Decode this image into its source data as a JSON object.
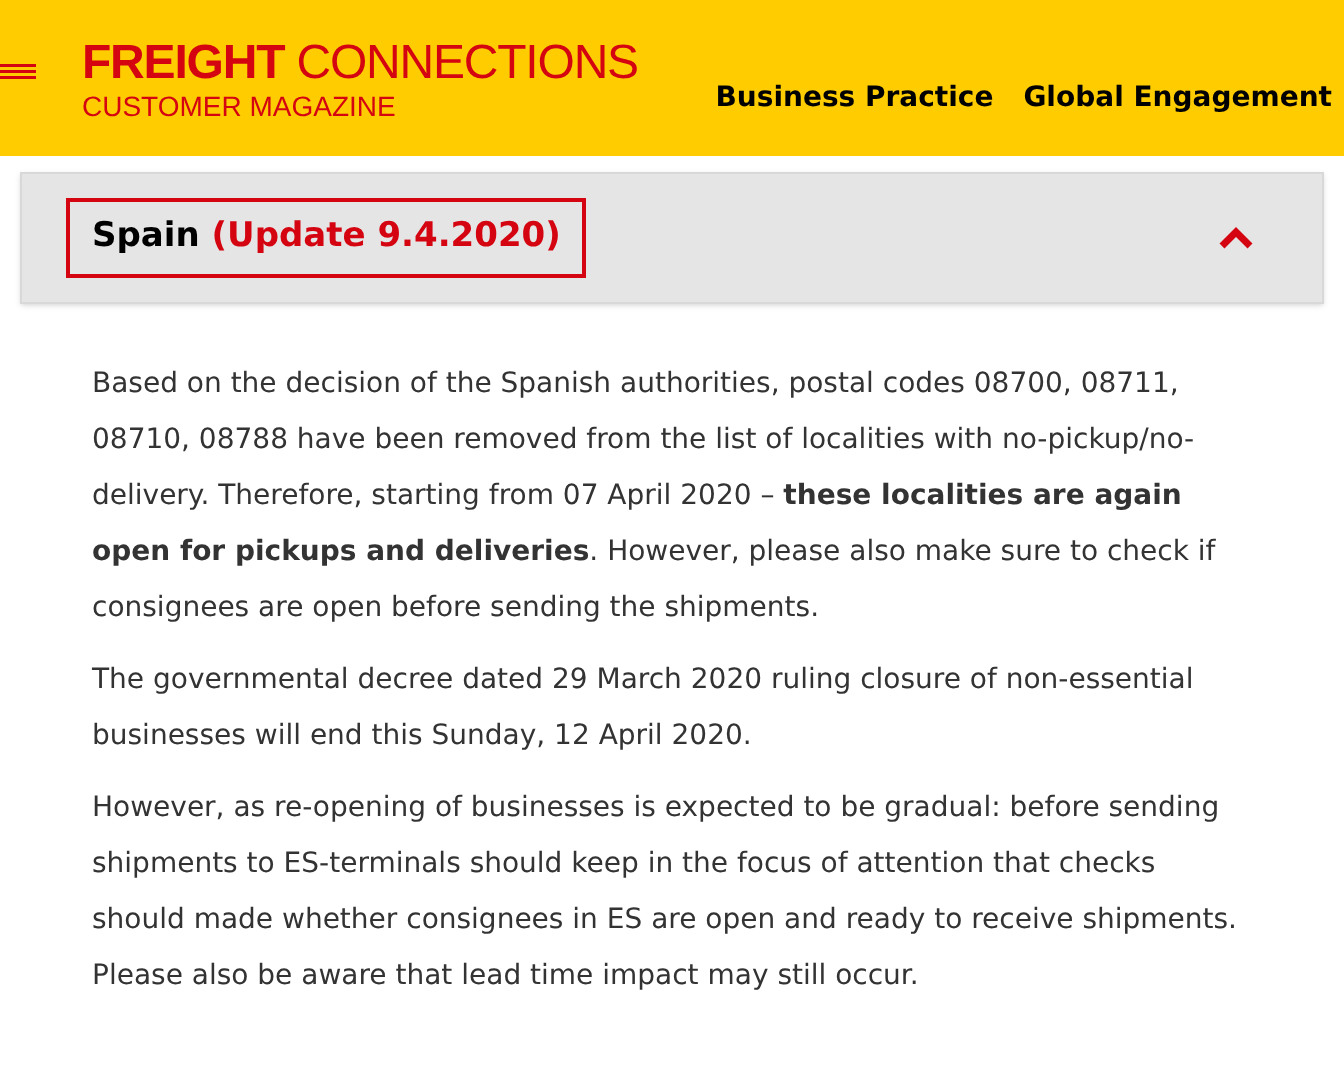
{
  "header": {
    "brand_bold": "FREIGHT",
    "brand_rest": "CONNECTIONS",
    "subtitle": "CUSTOMER MAGAZINE",
    "nav": [
      "Business Practice",
      "Global Engagement"
    ]
  },
  "accordion": {
    "title": "Spain",
    "update": "(Update 9.4.2020)",
    "expanded": true,
    "paragraphs": [
      "Based on the decision of the Spanish authorities, postal codes 08700, 08711, 08710, 08788 have been removed from the list of localities with no-pickup/no-delivery. Therefore, starting from 07 April 2020 – **these localities are again open for pickups and deliveries**. However, please also make sure to check if consignees are open before sending the shipments.",
      "The governmental decree dated 29 March 2020 ruling closure of non-essential businesses will end this Sunday, 12 April 2020.",
      "However, as re-opening of businesses is expected to be gradual: before sending shipments to ES-terminals should keep in the focus of attention that checks should made whether consignees in ES are open and ready to receive shipments. Please also be aware that lead time impact may still occur."
    ]
  }
}
